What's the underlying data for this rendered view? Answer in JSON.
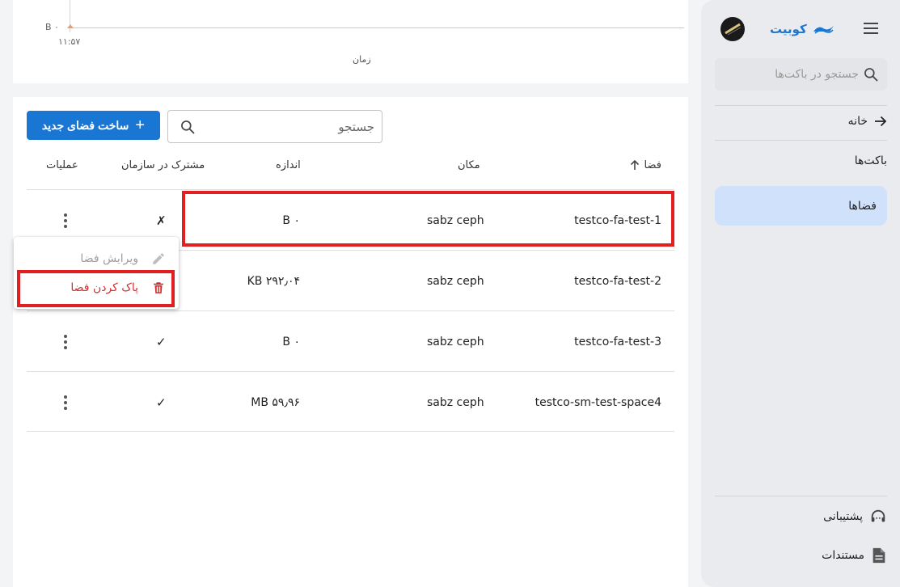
{
  "chart": {
    "y_tick": "۰ B",
    "x_tick": "۱۱:۵۷",
    "x_label": "زمان"
  },
  "toolbar": {
    "create_label": "ساخت فضای جدید",
    "search_placeholder": "جستجو"
  },
  "table": {
    "headers": {
      "space": "فضا",
      "location": "مکان",
      "size": "اندازه",
      "shared": "مشترک در سازمان",
      "operations": "عملیات"
    },
    "rows": [
      {
        "name": "testco-fa-test-1",
        "location": "sabz ceph",
        "size": "۰ B",
        "shared": "✗"
      },
      {
        "name": "testco-fa-test-2",
        "location": "sabz ceph",
        "size": "۲۹۲٫۰۴ KB",
        "shared": ""
      },
      {
        "name": "testco-fa-test-3",
        "location": "sabz ceph",
        "size": "۰ B",
        "shared": "✓"
      },
      {
        "name": "testco-sm-test-space4",
        "location": "sabz ceph",
        "size": "۵۹٫۹۶ MB",
        "shared": "✓"
      }
    ]
  },
  "context_menu": {
    "edit_label": "ویرایش فضا",
    "delete_label": "پاک کردن فضا"
  },
  "sidebar": {
    "brand": "کوبیت",
    "search_placeholder": "جستجو در باکت‌ها",
    "home_label": "خانه",
    "buckets_label": "باکت‌ها",
    "spaces_label": "فضاها",
    "support_label": "پشتیبانی",
    "docs_label": "مستندات"
  },
  "colors": {
    "accent": "#1976d2",
    "active_nav": "#cfe1fb",
    "danger": "#d32f2f",
    "highlight": "#e02020"
  }
}
